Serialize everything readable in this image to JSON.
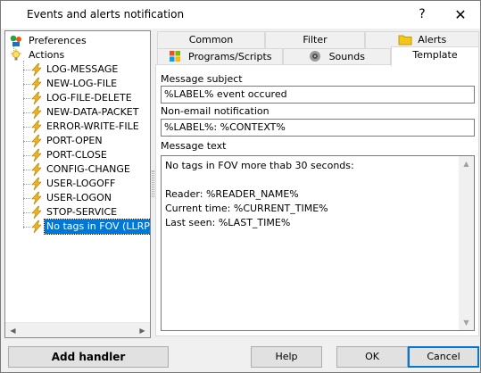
{
  "window": {
    "title": "Events and alerts notification",
    "help_glyph": "?",
    "close_glyph": "✕"
  },
  "tree": {
    "root_items": [
      {
        "label": "Preferences",
        "icon": "preferences-icon",
        "expander": "+"
      },
      {
        "label": "Actions",
        "icon": "actions-bulb-icon",
        "expander": "−"
      }
    ],
    "actions": [
      {
        "label": "LOG-MESSAGE"
      },
      {
        "label": "NEW-LOG-FILE"
      },
      {
        "label": "LOG-FILE-DELETE"
      },
      {
        "label": "NEW-DATA-PACKET"
      },
      {
        "label": "ERROR-WRITE-FILE"
      },
      {
        "label": "PORT-OPEN"
      },
      {
        "label": "PORT-CLOSE"
      },
      {
        "label": "CONFIG-CHANGE"
      },
      {
        "label": "USER-LOGOFF"
      },
      {
        "label": "USER-LOGON"
      },
      {
        "label": "STOP-SERVICE"
      },
      {
        "label": "No tags in FOV (LLRP_"
      }
    ],
    "selected_index": 11
  },
  "tabs": {
    "row1": [
      {
        "label": "Common"
      },
      {
        "label": "Filter"
      },
      {
        "label": "Alerts",
        "icon": "alerts-folder-icon"
      }
    ],
    "row2": [
      {
        "label": "Programs/Scripts",
        "icon": "windows-logo-icon"
      },
      {
        "label": "Sounds",
        "icon": "speaker-icon"
      },
      {
        "label": "Template",
        "active": true
      }
    ]
  },
  "template": {
    "subject_label": "Message subject",
    "subject_value": "%LABEL% event occured",
    "nonemail_label": "Non-email notification",
    "nonemail_value": "%LABEL%: %CONTEXT%",
    "text_label": "Message text",
    "text_value": "No tags in FOV more thab 30 seconds:\n\nReader: %READER_NAME%\nCurrent time: %CURRENT_TIME%\nLast seen: %LAST_TIME%"
  },
  "buttons": {
    "add_handler": "Add handler",
    "help": "Help",
    "ok": "OK",
    "cancel": "Cancel"
  },
  "colors": {
    "selection": "#0078d7",
    "lightning": "#f2b418"
  }
}
